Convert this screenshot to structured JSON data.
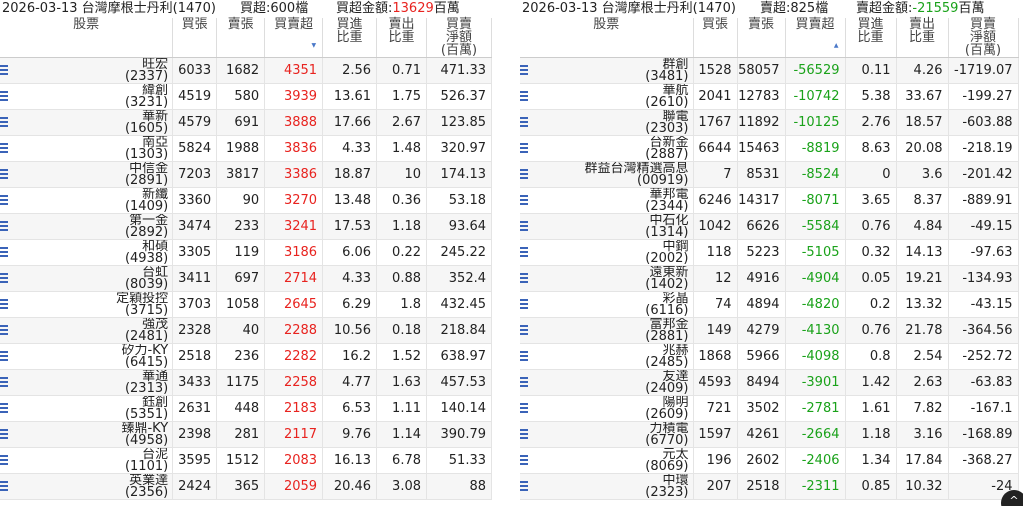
{
  "left": {
    "date_title": "2026-03-13 台灣摩根士丹利(1470)",
    "count_label": "買超:600檔",
    "amount_label": "買超金額:",
    "amount_value": "13629",
    "amount_unit": "百萬",
    "headers": {
      "stock": "股票",
      "buy": "買張",
      "sell": "賣張",
      "net": "買賣超",
      "buy_ratio_1": "買進",
      "buy_ratio_2": "比重",
      "sell_ratio_1": "賣出",
      "sell_ratio_2": "比重",
      "amount_1": "買賣",
      "amount_2": "淨額",
      "amount_3": "(百萬)"
    },
    "rows": [
      {
        "name": "旺宏",
        "code": "(2337)",
        "buy": "6033",
        "sell": "1682",
        "net": "4351",
        "bratio": "2.56",
        "sratio": "0.71",
        "amount": "471.33"
      },
      {
        "name": "緯創",
        "code": "(3231)",
        "buy": "4519",
        "sell": "580",
        "net": "3939",
        "bratio": "13.61",
        "sratio": "1.75",
        "amount": "526.37"
      },
      {
        "name": "華新",
        "code": "(1605)",
        "buy": "4579",
        "sell": "691",
        "net": "3888",
        "bratio": "17.66",
        "sratio": "2.67",
        "amount": "123.85"
      },
      {
        "name": "南亞",
        "code": "(1303)",
        "buy": "5824",
        "sell": "1988",
        "net": "3836",
        "bratio": "4.33",
        "sratio": "1.48",
        "amount": "320.97"
      },
      {
        "name": "中信金",
        "code": "(2891)",
        "buy": "7203",
        "sell": "3817",
        "net": "3386",
        "bratio": "18.87",
        "sratio": "10",
        "amount": "174.13"
      },
      {
        "name": "新纖",
        "code": "(1409)",
        "buy": "3360",
        "sell": "90",
        "net": "3270",
        "bratio": "13.48",
        "sratio": "0.36",
        "amount": "53.18"
      },
      {
        "name": "第一金",
        "code": "(2892)",
        "buy": "3474",
        "sell": "233",
        "net": "3241",
        "bratio": "17.53",
        "sratio": "1.18",
        "amount": "93.64"
      },
      {
        "name": "和碩",
        "code": "(4938)",
        "buy": "3305",
        "sell": "119",
        "net": "3186",
        "bratio": "6.06",
        "sratio": "0.22",
        "amount": "245.22"
      },
      {
        "name": "台虹",
        "code": "(8039)",
        "buy": "3411",
        "sell": "697",
        "net": "2714",
        "bratio": "4.33",
        "sratio": "0.88",
        "amount": "352.4"
      },
      {
        "name": "定穎投控",
        "code": "(3715)",
        "buy": "3703",
        "sell": "1058",
        "net": "2645",
        "bratio": "6.29",
        "sratio": "1.8",
        "amount": "432.45"
      },
      {
        "name": "強茂",
        "code": "(2481)",
        "buy": "2328",
        "sell": "40",
        "net": "2288",
        "bratio": "10.56",
        "sratio": "0.18",
        "amount": "218.84"
      },
      {
        "name": "矽力-KY",
        "code": "(6415)",
        "buy": "2518",
        "sell": "236",
        "net": "2282",
        "bratio": "16.2",
        "sratio": "1.52",
        "amount": "638.97"
      },
      {
        "name": "華通",
        "code": "(2313)",
        "buy": "3433",
        "sell": "1175",
        "net": "2258",
        "bratio": "4.77",
        "sratio": "1.63",
        "amount": "457.53"
      },
      {
        "name": "鈺創",
        "code": "(5351)",
        "buy": "2631",
        "sell": "448",
        "net": "2183",
        "bratio": "6.53",
        "sratio": "1.11",
        "amount": "140.14"
      },
      {
        "name": "臻鼎-KY",
        "code": "(4958)",
        "buy": "2398",
        "sell": "281",
        "net": "2117",
        "bratio": "9.76",
        "sratio": "1.14",
        "amount": "390.79"
      },
      {
        "name": "台泥",
        "code": "(1101)",
        "buy": "3595",
        "sell": "1512",
        "net": "2083",
        "bratio": "16.13",
        "sratio": "6.78",
        "amount": "51.33"
      },
      {
        "name": "英業達",
        "code": "(2356)",
        "buy": "2424",
        "sell": "365",
        "net": "2059",
        "bratio": "20.46",
        "sratio": "3.08",
        "amount": "88"
      }
    ]
  },
  "right": {
    "date_title": "2026-03-13 台灣摩根士丹利(1470)",
    "count_label": "賣超:825檔",
    "amount_label": "賣超金額:",
    "amount_value": "-21559",
    "amount_unit": "百萬",
    "headers": {
      "stock": "股票",
      "buy": "買張",
      "sell": "賣張",
      "net": "買賣超",
      "buy_ratio_1": "買進",
      "buy_ratio_2": "比重",
      "sell_ratio_1": "賣出",
      "sell_ratio_2": "比重",
      "amount_1": "買賣",
      "amount_2": "淨額",
      "amount_3": "(百萬)"
    },
    "rows": [
      {
        "name": "群創",
        "code": "(3481)",
        "buy": "1528",
        "sell": "58057",
        "net": "-56529",
        "bratio": "0.11",
        "sratio": "4.26",
        "amount": "-1719.07"
      },
      {
        "name": "華航",
        "code": "(2610)",
        "buy": "2041",
        "sell": "12783",
        "net": "-10742",
        "bratio": "5.38",
        "sratio": "33.67",
        "amount": "-199.27"
      },
      {
        "name": "聯電",
        "code": "(2303)",
        "buy": "1767",
        "sell": "11892",
        "net": "-10125",
        "bratio": "2.76",
        "sratio": "18.57",
        "amount": "-603.88"
      },
      {
        "name": "台新金",
        "code": "(2887)",
        "buy": "6644",
        "sell": "15463",
        "net": "-8819",
        "bratio": "8.63",
        "sratio": "20.08",
        "amount": "-218.19"
      },
      {
        "name": "群益台灣精選高息",
        "code": "(00919)",
        "buy": "7",
        "sell": "8531",
        "net": "-8524",
        "bratio": "0",
        "sratio": "3.6",
        "amount": "-201.42"
      },
      {
        "name": "華邦電",
        "code": "(2344)",
        "buy": "6246",
        "sell": "14317",
        "net": "-8071",
        "bratio": "3.65",
        "sratio": "8.37",
        "amount": "-889.91"
      },
      {
        "name": "中石化",
        "code": "(1314)",
        "buy": "1042",
        "sell": "6626",
        "net": "-5584",
        "bratio": "0.76",
        "sratio": "4.84",
        "amount": "-49.15"
      },
      {
        "name": "中鋼",
        "code": "(2002)",
        "buy": "118",
        "sell": "5223",
        "net": "-5105",
        "bratio": "0.32",
        "sratio": "14.13",
        "amount": "-97.63"
      },
      {
        "name": "遠東新",
        "code": "(1402)",
        "buy": "12",
        "sell": "4916",
        "net": "-4904",
        "bratio": "0.05",
        "sratio": "19.21",
        "amount": "-134.93"
      },
      {
        "name": "彩晶",
        "code": "(6116)",
        "buy": "74",
        "sell": "4894",
        "net": "-4820",
        "bratio": "0.2",
        "sratio": "13.32",
        "amount": "-43.15"
      },
      {
        "name": "富邦金",
        "code": "(2881)",
        "buy": "149",
        "sell": "4279",
        "net": "-4130",
        "bratio": "0.76",
        "sratio": "21.78",
        "amount": "-364.56"
      },
      {
        "name": "兆赫",
        "code": "(2485)",
        "buy": "1868",
        "sell": "5966",
        "net": "-4098",
        "bratio": "0.8",
        "sratio": "2.54",
        "amount": "-252.72"
      },
      {
        "name": "友達",
        "code": "(2409)",
        "buy": "4593",
        "sell": "8494",
        "net": "-3901",
        "bratio": "1.42",
        "sratio": "2.63",
        "amount": "-63.83"
      },
      {
        "name": "陽明",
        "code": "(2609)",
        "buy": "721",
        "sell": "3502",
        "net": "-2781",
        "bratio": "1.61",
        "sratio": "7.82",
        "amount": "-167.1"
      },
      {
        "name": "力積電",
        "code": "(6770)",
        "buy": "1597",
        "sell": "4261",
        "net": "-2664",
        "bratio": "1.18",
        "sratio": "3.16",
        "amount": "-168.89"
      },
      {
        "name": "元太",
        "code": "(8069)",
        "buy": "196",
        "sell": "2602",
        "net": "-2406",
        "bratio": "1.34",
        "sratio": "17.84",
        "amount": "-368.27"
      },
      {
        "name": "中環",
        "code": "(2323)",
        "buy": "207",
        "sell": "2518",
        "net": "-2311",
        "bratio": "0.85",
        "sratio": "10.32",
        "amount": "-24"
      }
    ]
  },
  "icons": {
    "row_menu": "list-icon",
    "sort": "sort-caret-icon",
    "scroll": "chevron-up-icon"
  },
  "colors": {
    "buy": "#e8231f",
    "sell": "#1aa21a",
    "icon": "#3a63b8"
  }
}
